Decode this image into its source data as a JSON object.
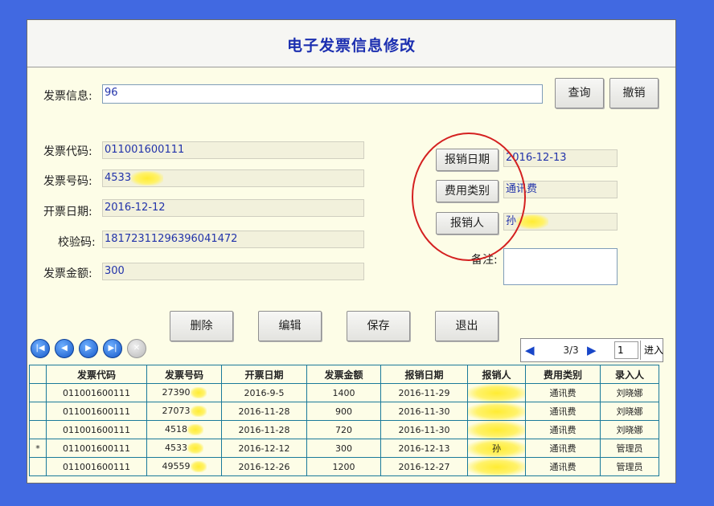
{
  "title": "电子发票信息修改",
  "search": {
    "label": "发票信息:",
    "value": "96",
    "query_label": "查询",
    "cancel_label": "撤销"
  },
  "fields": {
    "code": {
      "label": "发票代码:",
      "value": "011001600111"
    },
    "number": {
      "label": "发票号码:",
      "value": "4533"
    },
    "date": {
      "label": "开票日期:",
      "value": "2016-12-12"
    },
    "check": {
      "label": "校验码:",
      "value": "18172311296396041472"
    },
    "amount": {
      "label": "发票金额:",
      "value": "300"
    }
  },
  "right": {
    "reimburse_date": {
      "button": "报销日期",
      "value": "2016-12-13"
    },
    "expense_type": {
      "button": "费用类别",
      "value": "通讯费"
    },
    "reimburser": {
      "button": "报销人",
      "value": "孙"
    },
    "remark": {
      "label": "备注:",
      "value": ""
    }
  },
  "actions": {
    "delete": "删除",
    "edit": "编辑",
    "save": "保存",
    "exit": "退出"
  },
  "nav": {
    "first": "first-icon",
    "prev": "prev-icon",
    "next": "next-icon",
    "last": "last-icon",
    "cancel": "cancel-icon"
  },
  "pager": {
    "position": "3/3",
    "input": "1",
    "go": "进入"
  },
  "table": {
    "headers": [
      "发票代码",
      "发票号码",
      "开票日期",
      "发票金额",
      "报销日期",
      "报销人",
      "费用类别",
      "录入人"
    ],
    "rows": [
      {
        "marker": "",
        "cells": [
          "011001600111",
          "27390",
          "2016-9-5",
          "1400",
          "2016-11-29",
          "",
          "通讯费",
          "刘晓娜"
        ]
      },
      {
        "marker": "",
        "cells": [
          "011001600111",
          "27073",
          "2016-11-28",
          "900",
          "2016-11-30",
          "",
          "通讯费",
          "刘晓娜"
        ]
      },
      {
        "marker": "",
        "cells": [
          "011001600111",
          "4518",
          "2016-11-28",
          "720",
          "2016-11-30",
          "",
          "通讯费",
          "刘晓娜"
        ]
      },
      {
        "marker": "*",
        "cells": [
          "011001600111",
          "4533",
          "2016-12-12",
          "300",
          "2016-12-13",
          "孙",
          "通讯费",
          "管理员"
        ]
      },
      {
        "marker": "",
        "cells": [
          "011001600111",
          "49559",
          "2016-12-26",
          "1200",
          "2016-12-27",
          "",
          "通讯费",
          "管理员"
        ]
      }
    ]
  }
}
